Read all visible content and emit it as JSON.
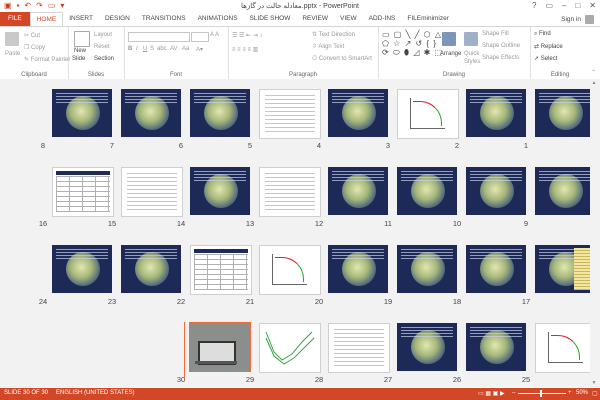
{
  "window": {
    "title": "معادله حالت در گازها.pptx - PowerPoint",
    "controls": [
      "?",
      "▭",
      "–",
      "□",
      "✕"
    ]
  },
  "qat": {
    "icons": [
      "powerpoint-logo-icon",
      "save-icon",
      "undo-icon",
      "redo-icon",
      "slideshow-icon",
      "customize-icon"
    ]
  },
  "tabs": [
    "FILE",
    "HOME",
    "INSERT",
    "DESIGN",
    "TRANSITIONS",
    "ANIMATIONS",
    "SLIDE SHOW",
    "REVIEW",
    "VIEW",
    "ADD-INS",
    "FILEminimizer"
  ],
  "active_tab": "HOME",
  "signin": "Sign in",
  "ribbon": {
    "clipboard": {
      "label": "Clipboard",
      "paste": "Paste",
      "cut": "Cut",
      "copy": "Copy",
      "format_painter": "Format Painter"
    },
    "slides": {
      "label": "Slides",
      "new_slide": "New",
      "new_slide2": "Slide",
      "layout": "Layout",
      "reset": "Reset",
      "section": "Section"
    },
    "font": {
      "label": "Font",
      "bold": "B",
      "italic": "I",
      "underline": "U",
      "strike": "S",
      "shadow": "abc",
      "spacing": "AV",
      "case": "Aa"
    },
    "paragraph": {
      "label": "Paragraph",
      "text_direction": "Text Direction",
      "align_text": "Align Text",
      "convert_smartart": "Convert to SmartArt"
    },
    "drawing": {
      "label": "Drawing",
      "arrange": "Arrange",
      "quick_styles": "Quick",
      "quick_styles2": "Styles",
      "shape_fill": "Shape Fill",
      "shape_outline": "Shape Outline",
      "shape_effects": "Shape Effects"
    },
    "editing": {
      "label": "Editing",
      "find": "Find",
      "replace": "Replace",
      "select": "Select"
    }
  },
  "slides": [
    {
      "n": "1",
      "style": "dark"
    },
    {
      "n": "2",
      "style": "dark"
    },
    {
      "n": "3",
      "style": "white-chart"
    },
    {
      "n": "4",
      "style": "dark"
    },
    {
      "n": "5",
      "style": "white"
    },
    {
      "n": "6",
      "style": "dark"
    },
    {
      "n": "7",
      "style": "dark"
    },
    {
      "n": "8",
      "style": "dark"
    },
    {
      "n": "9",
      "style": "dark"
    },
    {
      "n": "10",
      "style": "dark"
    },
    {
      "n": "11",
      "style": "dark"
    },
    {
      "n": "12",
      "style": "dark"
    },
    {
      "n": "13",
      "style": "white"
    },
    {
      "n": "14",
      "style": "dark"
    },
    {
      "n": "15",
      "style": "white"
    },
    {
      "n": "16",
      "style": "table"
    },
    {
      "n": "17",
      "style": "split"
    },
    {
      "n": "18",
      "style": "dark"
    },
    {
      "n": "19",
      "style": "dark"
    },
    {
      "n": "20",
      "style": "dark"
    },
    {
      "n": "21",
      "style": "white-chart"
    },
    {
      "n": "22",
      "style": "table"
    },
    {
      "n": "23",
      "style": "dark"
    },
    {
      "n": "24",
      "style": "dark"
    },
    {
      "n": "25",
      "style": "white-chart"
    },
    {
      "n": "26",
      "style": "dark"
    },
    {
      "n": "27",
      "style": "dark"
    },
    {
      "n": "28",
      "style": "white"
    },
    {
      "n": "29",
      "style": "green"
    },
    {
      "n": "30",
      "style": "photo"
    }
  ],
  "status": {
    "slide": "SLIDE 30 OF 30",
    "language": "ENGLISH (UNITED STATES)",
    "zoom": "50%"
  },
  "colors": {
    "accent": "#d24726",
    "thumb_bg": "#1d2a57",
    "workspace": "#f2f2f2"
  }
}
